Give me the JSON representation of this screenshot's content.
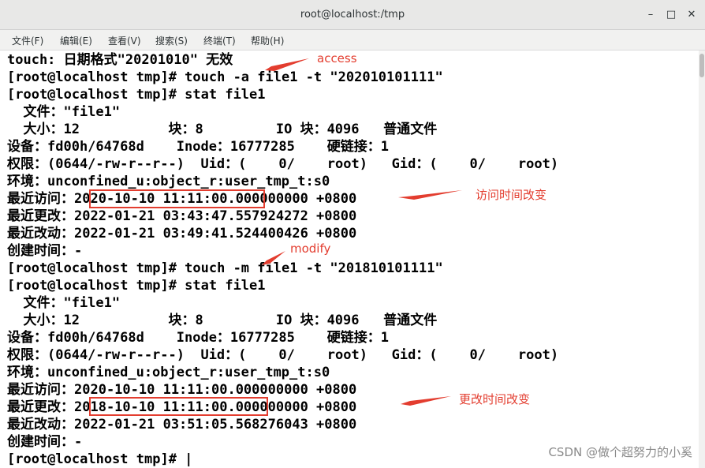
{
  "window": {
    "title": "root@localhost:/tmp"
  },
  "menu": [
    "文件(F)",
    "编辑(E)",
    "查看(V)",
    "搜索(S)",
    "终端(T)",
    "帮助(H)"
  ],
  "lines": [
    "touch: 日期格式\"20201010\" 无效",
    "[root@localhost tmp]# touch -a file1 -t \"202010101111\"",
    "[root@localhost tmp]# stat file1",
    "  文件：\"file1\"",
    "  大小：12           块：8         IO 块：4096   普通文件",
    "设备：fd00h/64768d    Inode：16777285    硬链接：1",
    "权限：(0644/-rw-r--r--)  Uid：(    0/    root)   Gid：(    0/    root)",
    "环境：unconfined_u:object_r:user_tmp_t:s0",
    "最近访问：2020-10-10 11:11:00.000000000 +0800",
    "最近更改：2022-01-21 03:43:47.557924272 +0800",
    "最近改动：2022-01-21 03:49:41.524400426 +0800",
    "创建时间：-",
    "[root@localhost tmp]# touch -m file1 -t \"201810101111\"",
    "[root@localhost tmp]# stat file1",
    "  文件：\"file1\"",
    "  大小：12           块：8         IO 块：4096   普通文件",
    "设备：fd00h/64768d    Inode：16777285    硬链接：1",
    "权限：(0644/-rw-r--r--)  Uid：(    0/    root)   Gid：(    0/    root)",
    "环境：unconfined_u:object_r:user_tmp_t:s0",
    "最近访问：2020-10-10 11:11:00.000000000 +0800",
    "最近更改：2018-10-10 11:11:00.000000000 +0800",
    "最近改动：2022-01-21 03:51:05.568276043 +0800",
    "创建时间：-",
    "[root@localhost tmp]# |"
  ],
  "annotations": {
    "access": "access",
    "access_changed": "访问时间改变",
    "modify": "modify",
    "modify_changed": "更改时间改变"
  },
  "watermark": "CSDN @做个超努力的小奚",
  "colors": {
    "annotation": "#e33d2f",
    "titlebar": "#e8e8e7"
  }
}
